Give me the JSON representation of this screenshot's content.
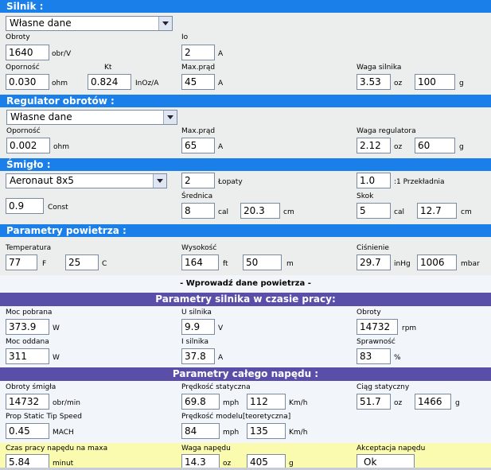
{
  "silnik": {
    "title": "Silnik :",
    "select": "Własne dane",
    "obroty_label": "Obroty",
    "obroty": "1640",
    "obroty_unit": "obr/V",
    "io_label": "Io",
    "io": "2",
    "io_unit": "A",
    "opor_label": "Oporność",
    "opor": "0.030",
    "opor_unit": "ohm",
    "kt_label": "Kt",
    "kt": "0.824",
    "kt_unit": "InOz/A",
    "maxprad_label": "Max.prąd",
    "maxprad": "45",
    "maxprad_unit": "A",
    "waga_label": "Waga silnika",
    "waga_oz": "3.53",
    "oz_unit": "oz",
    "waga_g": "100",
    "g_unit": "g"
  },
  "regulator": {
    "title": "Regulator obrotów  :",
    "select": "Własne dane",
    "opor_label": "Oporność",
    "opor": "0.002",
    "opor_unit": "ohm",
    "maxprad_label": "Max.prąd",
    "maxprad": "65",
    "maxprad_unit": "A",
    "waga_label": "Waga regulatora",
    "waga_oz": "2.12",
    "oz_unit": "oz",
    "waga_g": "60",
    "g_unit": "g"
  },
  "smiglo": {
    "title": "Śmigło :",
    "select": "Aeronaut 8x5",
    "lopaty": "2",
    "lopaty_label": "Łopaty",
    "przekl": "1.0",
    "przekl_label": ":1 Przekładnia",
    "const": "0.9",
    "const_label": "Const",
    "srednica_label": "Średnica",
    "srednica_cal": "8",
    "cal_unit": "cal",
    "srednica_cm": "20.3",
    "cm_unit": "cm",
    "skok_label": "Skok",
    "skok_cal": "5",
    "skok_cm": "12.7"
  },
  "powietrze": {
    "title": "Parametry powietrza :",
    "temp_label": "Temperatura",
    "temp_f": "77",
    "f_unit": "F",
    "temp_c": "25",
    "c_unit": "C",
    "wys_label": "Wysokość",
    "wys_ft": "164",
    "ft_unit": "ft",
    "wys_m": "50",
    "m_unit": "m",
    "cisn_label": "Ciśnienie",
    "cisn_inhg": "29.7",
    "inhg_unit": "inHg",
    "cisn_mbar": "1006",
    "mbar_unit": "mbar",
    "link": "- Wprowadź dane powietrza -"
  },
  "praca": {
    "title": "Parametry silnika w czasie pracy:",
    "moc_pob_label": "Moc pobrana",
    "moc_pob": "373.9",
    "w_unit": "W",
    "u_label": "U silnika",
    "u": "9.9",
    "v_unit": "V",
    "obroty_label": "Obroty",
    "obroty": "14732",
    "rpm_unit": "rpm",
    "moc_odd_label": "Moc oddana",
    "moc_odd": "311",
    "i_label": "I silnika",
    "i": "37.8",
    "a_unit": "A",
    "spraw_label": "Sprawność",
    "spraw": "83",
    "pct_unit": "%"
  },
  "naped": {
    "title": "Parametry całego napędu :",
    "obr_label": "Obroty śmigła",
    "obr": "14732",
    "obr_unit": "obr/min",
    "pred_stat_label": "Prędkość statyczna",
    "pred_stat_mph": "69.8",
    "mph_unit": "mph",
    "pred_stat_kmh": "112",
    "kmh_unit": "Km/h",
    "ciag_label": "Ciąg statyczny",
    "ciag_oz": "51.7",
    "oz_unit": "oz",
    "ciag_g": "1466",
    "g_unit": "g",
    "tip_label": "Prop Static Tip Speed",
    "tip": "0.45",
    "mach_unit": "MACH",
    "pred_mod_label": "Prędkość modelu[teoretyczna]",
    "pred_mod_mph": "84",
    "pred_mod_kmh": "135",
    "czas_label": "Czas pracy napędu na maxa",
    "czas": "5.84",
    "czas_unit": "minut",
    "waga_label": "Waga napędu",
    "waga_oz": "14.3",
    "waga_g": "405",
    "akc_label": "Akceptacja napędu",
    "akc": "Ok"
  }
}
